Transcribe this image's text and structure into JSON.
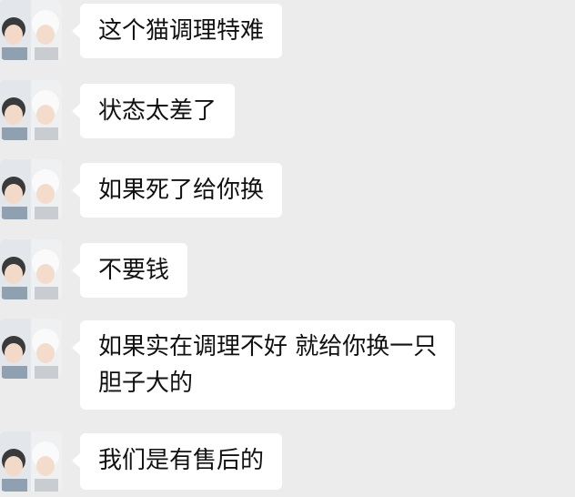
{
  "messages": [
    {
      "lines": [
        "这个猫调理特难"
      ]
    },
    {
      "lines": [
        "状态太差了"
      ]
    },
    {
      "lines": [
        "如果死了给你换"
      ]
    },
    {
      "lines": [
        "不要钱"
      ]
    },
    {
      "lines": [
        "如果实在调理不好 就给你换一只",
        "胆子大的"
      ]
    },
    {
      "lines": [
        "我们是有售后的"
      ]
    }
  ],
  "avatar": {
    "icon": "contact-avatar-icon"
  },
  "colors": {
    "background": "#ececec",
    "bubble": "#ffffff",
    "text": "#111111"
  }
}
